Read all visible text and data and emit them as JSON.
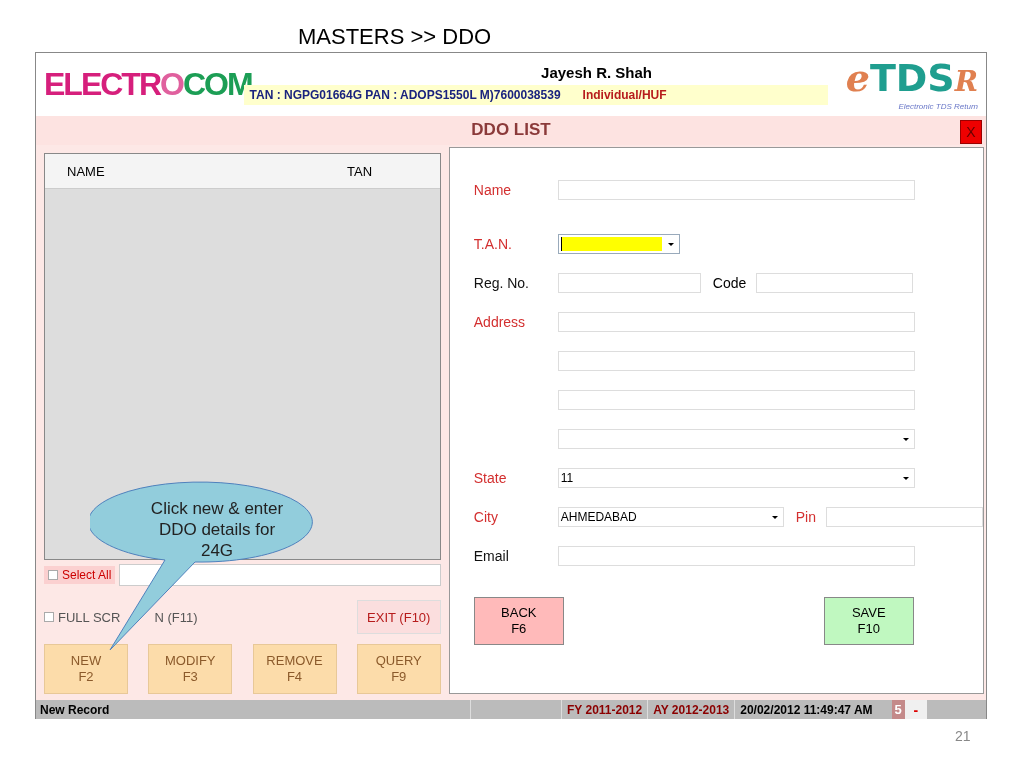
{
  "slide_title": "MASTERS >> DDO",
  "header": {
    "logo_parts": [
      {
        "text": "ELECTR",
        "color": "#d61f7c"
      },
      {
        "text": "O",
        "color": "#e0609e"
      },
      {
        "text": "COM",
        "color": "#1c9e55"
      }
    ],
    "company": "Jayesh R. Shah",
    "details": "TAN : NGPG01664G  PAN : ADOPS1550L  M)7600038539",
    "category": "Individual/HUF",
    "product_logo": {
      "prefix": "e",
      "main": "TDS",
      "suffix": "R",
      "tagline": "Electronic TDS Return"
    }
  },
  "window": {
    "title": "DDO LIST",
    "close": "X"
  },
  "list": {
    "columns": [
      "NAME",
      "TAN"
    ],
    "select_all": {
      "label": "Select All",
      "checked": false
    }
  },
  "full_screen": {
    "label_parts": [
      "FULL SCR",
      "N (F11)"
    ],
    "checked": false
  },
  "exit_button": "EXIT (F10)",
  "actions": [
    {
      "label": "NEW",
      "key": "F2"
    },
    {
      "label": "MODIFY",
      "key": "F3"
    },
    {
      "label": "REMOVE",
      "key": "F4"
    },
    {
      "label": "QUERY",
      "key": "F9"
    }
  ],
  "form": [
    {
      "label": "Name",
      "required": true,
      "fields": [
        {
          "kind": "text"
        }
      ]
    },
    {
      "label": "T.A.N.",
      "required": true,
      "fields": [
        {
          "kind": "combo",
          "highlighted": true
        }
      ]
    },
    {
      "label": "Reg. No.",
      "required": false,
      "fields": [
        {
          "kind": "text"
        },
        {
          "kind": "text",
          "label": "Code",
          "required": false
        }
      ]
    },
    {
      "label": "Address",
      "required": true,
      "fields": [
        {
          "kind": "text"
        }
      ]
    },
    {
      "fields": [
        {
          "kind": "text"
        }
      ]
    },
    {
      "fields": [
        {
          "kind": "text"
        }
      ]
    },
    {
      "fields": [
        {
          "kind": "combo"
        }
      ]
    },
    {
      "label": "State",
      "required": true,
      "fields": [
        {
          "kind": "combo",
          "value": "11"
        }
      ]
    },
    {
      "label": "City",
      "required": true,
      "fields": [
        {
          "kind": "combo",
          "value": "AHMEDABAD"
        },
        {
          "kind": "text",
          "label": "Pin",
          "required": true
        }
      ]
    },
    {
      "label": "Email",
      "required": false,
      "fields": [
        {
          "kind": "text"
        }
      ]
    }
  ],
  "back_button": {
    "label": "BACK",
    "key": "F6"
  },
  "save_button": {
    "label": "SAVE",
    "key": "F10"
  },
  "status_bar": {
    "message": "New Record",
    "fy": "FY 2011-2012",
    "ay": "AY 2012-2013",
    "datetime": "20/02/2012 11:49:47 AM",
    "badge": "5",
    "minimize": "-"
  },
  "callout": "Click new & enter DDO details for 24G",
  "slide_number": "21"
}
